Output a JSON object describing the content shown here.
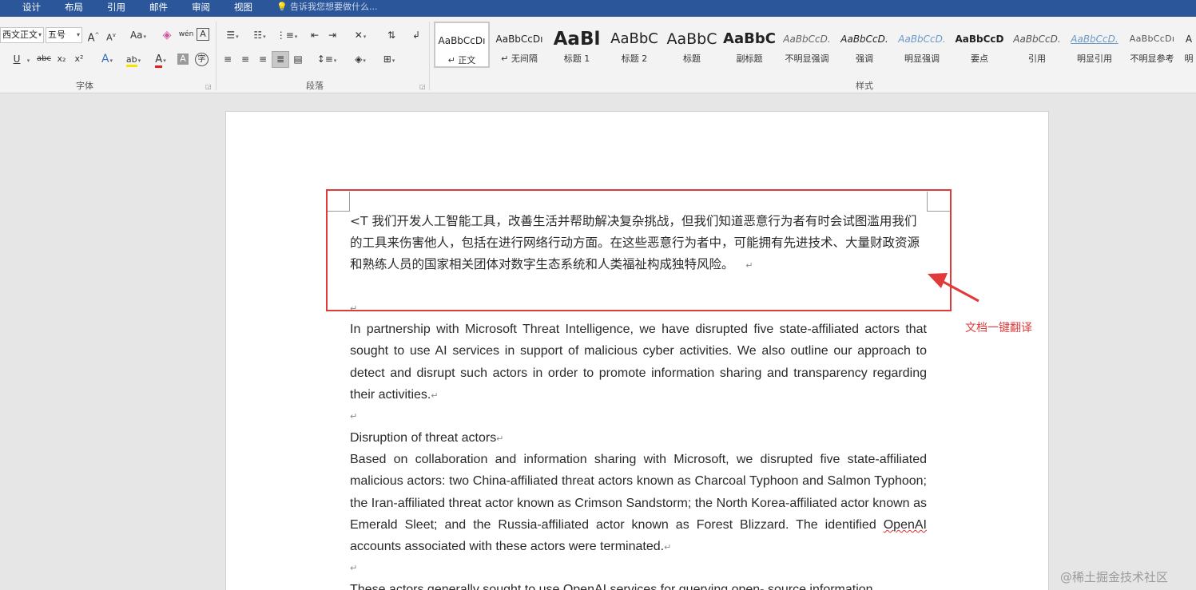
{
  "tabs": [
    {
      "label": "设计"
    },
    {
      "label": "布局"
    },
    {
      "label": "引用"
    },
    {
      "label": "邮件"
    },
    {
      "label": "审阅"
    },
    {
      "label": "视图"
    }
  ],
  "tell_me": "告诉我您想要做什么...",
  "ribbon": {
    "font": {
      "group_label": "字体",
      "font_name": "西文正文",
      "font_size": "五号",
      "grow_glyph": "A",
      "shrink_glyph": "A",
      "case_glyph": "Aa",
      "phonetic_glyph": "wén",
      "border_char_glyph": "A",
      "underline_glyph": "U",
      "strike_glyph": "abc",
      "subscript_glyph": "x₂",
      "superscript_glyph": "x²",
      "effect_glyph": "A",
      "font_color_glyph": "A",
      "shading_glyph": "A",
      "enclose_glyph": "字"
    },
    "paragraph": {
      "group_label": "段落"
    },
    "styles": {
      "group_label": "样式",
      "items": [
        {
          "preview": "AaBbCcDı",
          "name": "↵ 正文"
        },
        {
          "preview": "AaBbCcDı",
          "name": "↵ 无间隔"
        },
        {
          "preview": "AaBl",
          "name": "标题 1"
        },
        {
          "preview": "AaBbC",
          "name": "标题 2"
        },
        {
          "preview": "AaBbC",
          "name": "标题"
        },
        {
          "preview": "AaBbC",
          "name": "副标题"
        },
        {
          "preview": "AaBbCcD.",
          "name": "不明显强调"
        },
        {
          "preview": "AaBbCcD.",
          "name": "强调"
        },
        {
          "preview": "AaBbCcD.",
          "name": "明显强调"
        },
        {
          "preview": "AaBbCcD",
          "name": "要点"
        },
        {
          "preview": "AaBbCcD.",
          "name": "引用"
        },
        {
          "preview": "AaBbCcD.",
          "name": "明显引用"
        },
        {
          "preview": "AaBbCcDı",
          "name": "不明显参考"
        },
        {
          "preview": "A",
          "name": "明"
        }
      ]
    }
  },
  "document": {
    "translated_paragraph": "<T 我们开发人工智能工具，改善生活并帮助解决复杂挑战，但我们知道恶意行为者有时会试图滥用我们的工具来伤害他人，包括在进行网络行动方面。在这些恶意行为者中，可能拥有先进技术、大量财政资源和熟练人员的国家相关团体对数字生态系统和人类福祉构成独特风险。",
    "para_mark": "↵",
    "paragraph_1": "In partnership with Microsoft Threat Intelligence, we have disrupted five state-affiliated actors that sought to use AI services in support of malicious cyber activities. We also outline our approach to detect and disrupt such actors in order to promote information sharing and transparency regarding their activities.",
    "heading": "Disruption of threat actors",
    "paragraph_2_before": "Based on collaboration and information sharing with Microsoft, we disrupted five state-affiliated malicious actors: two China-affiliated threat actors known as Charcoal Typhoon and Salmon Typhoon; the Iran-affiliated threat actor known as Crimson Sandstorm; the North Korea-affiliated actor known as Emerald Sleet; and the Russia-affiliated actor known as Forest Blizzard. The identified ",
    "paragraph_2_flagged": "OpenAI",
    "paragraph_2_after": " accounts associated with these actors were terminated.",
    "paragraph_3": "These actors generally sought to use OpenAI services for querying open- source information"
  },
  "annotation": {
    "label": "文档一键翻译",
    "color": "#e03a3a"
  },
  "watermark": "@稀土掘金技术社区",
  "colors": {
    "title_bar": "#2b579a",
    "ribbon_bg": "#f3f3f3",
    "canvas_bg": "#e6e6e6",
    "highlight_yellow": "#f5e400",
    "font_color_red": "#e02020"
  }
}
